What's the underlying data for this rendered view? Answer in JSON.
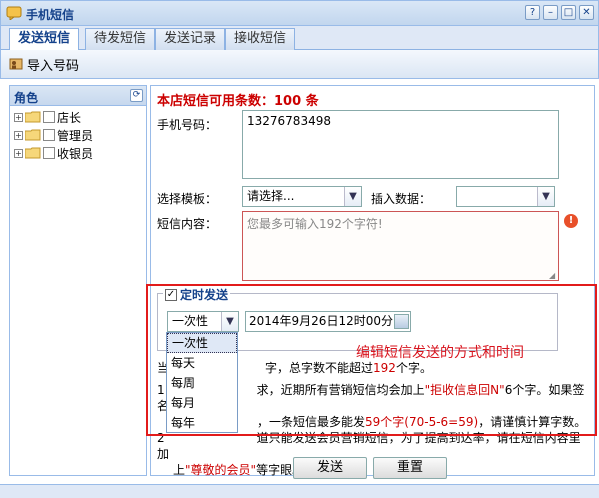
{
  "window": {
    "title": "手机短信",
    "help": "?",
    "minimize": "–",
    "maximize": "□",
    "close": "✕"
  },
  "tabs": [
    {
      "label": "发送短信",
      "active": true
    },
    {
      "label": "待发短信",
      "active": false
    },
    {
      "label": "发送记录",
      "active": false
    },
    {
      "label": "接收短信",
      "active": false
    }
  ],
  "toolbar": {
    "import_label": "导入号码"
  },
  "roles": {
    "title": "角色",
    "items": [
      "店长",
      "管理员",
      "收银员"
    ]
  },
  "form": {
    "quota_label": "本店短信可用条数：",
    "quota_value": "100 条",
    "phone_label": "手机号码：",
    "phone_value": "13276783498",
    "template_label": "选择模板：",
    "template_value": "请选择...",
    "insert_label": "插入数据：",
    "insert_value": "",
    "content_label": "短信内容：",
    "content_placeholder": "您最多可输入192个字符!",
    "timed_label": "定时发送",
    "timed_checked": true,
    "mode_value": "一次性",
    "datetime_value": "2014年9月26日12时00分",
    "send_label": "发送",
    "reset_label": "重置"
  },
  "mode_options": [
    "一次性",
    "每天",
    "每周",
    "每月",
    "每年"
  ],
  "notes": {
    "line1_pre": "当",
    "line1_post": "字，总字数不能超过",
    "line1_num": "192",
    "line1_end": "个字。",
    "line2_num": "1",
    "line2_a": "求，近期所有营销短信均会加上",
    "line2_red": "\"拒收信息回N\"",
    "line2_b": "6个字。如果签名",
    "line3_a": "，一条短信最多能发",
    "line3_red": "59个字(70-5-6=59)",
    "line3_b": "，请谨慎计算字数。",
    "line4_num": "2",
    "line4_a": "道只能发送会员营销短信，为了提高到达率，请在短信内容里加",
    "line5_a": "上",
    "line5_red": "\"尊敬的会员\"",
    "line5_b": "等字眼。"
  },
  "annotation": {
    "text": "编辑短信发送的方式和时间",
    "color": "#e21b1b"
  }
}
